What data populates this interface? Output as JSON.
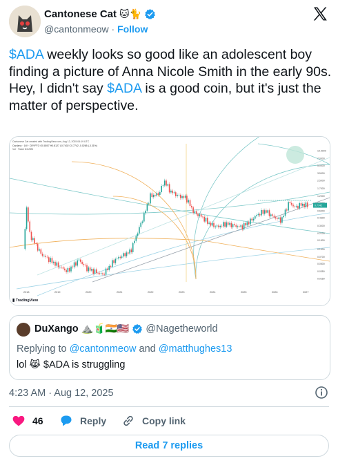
{
  "author": {
    "display_name": "Cantonese Cat",
    "name_emoji": "🐱🐈",
    "handle": "@cantonmeow",
    "separator": "·",
    "follow_label": "Follow"
  },
  "tweet": {
    "cashtag": "$ADA",
    "line1_rest": " weekly looks so good like an adolescent boy finding a picture of Anna Nicole Smith in the early 90s.",
    "line2_pre": "Hey, I didn't say ",
    "line2_rest": " is a good coin, but it's just the matter of perspective."
  },
  "chart": {
    "header_text": "Cantonese Cat created with TradingView.com, Aug 12, 2025 04:19 UTC",
    "symbol_text": "Cardano · 1W · CRYPTO   O0.8007 H0.8127 L0.7402 C0.7742 -0.0265 (-3.31%)",
    "vol_text": "Vol · Ticker  83.25M",
    "watermark": "TradingView",
    "x_ticks": [
      "2018",
      "2019",
      "2020",
      "2021",
      "2022",
      "2023",
      "2024",
      "2025",
      "2026",
      "2027"
    ],
    "y_ticks": [
      "10.0000",
      "7.0000",
      "5.0000",
      "3.5000",
      "2.5000",
      "1.7000",
      "1.2000",
      "0.8700",
      "0.6000",
      "0.4300",
      "0.3000",
      "0.2100",
      "0.1500",
      "0.1000",
      "0.0700",
      "0.0500",
      "0.0350",
      "0.0250"
    ],
    "current_price_label": "0.7742",
    "colors": {
      "up": "#26a69a",
      "down": "#ef5350",
      "fib_teal": "#7ec9c9",
      "fib_orange": "#f0b05a",
      "fib_blue": "#9ed3e6",
      "trend": "#9aa3ad"
    }
  },
  "chart_data": {
    "type": "candlestick",
    "title": "",
    "x": [
      "2018",
      "2019",
      "2020",
      "2021",
      "2022",
      "2023",
      "2024",
      "2025"
    ],
    "approx_close": [
      0.3,
      0.045,
      0.035,
      1.2,
      1.3,
      0.28,
      0.6,
      0.77
    ],
    "yscale": "log",
    "ylim": [
      0.02,
      10.0
    ]
  },
  "quote": {
    "display_name": "DuXango",
    "name_emoji": "⛰️🧃🇮🇳🇺🇸",
    "handle": "@Nagetheworld",
    "reply_prefix": "Replying to ",
    "reply_mention1": "@cantonmeow",
    "reply_and": " and ",
    "reply_mention2": "@matthughes13",
    "body_pre": "lol ",
    "body_emoji": "😹",
    "body_cashtag": " $ADA is struggling"
  },
  "meta": {
    "timestamp": "4:23 AM · Aug 12, 2025"
  },
  "actions": {
    "like_count": "46",
    "reply_label": "Reply",
    "copy_label": "Copy link",
    "read_replies_label": "Read 7 replies"
  }
}
